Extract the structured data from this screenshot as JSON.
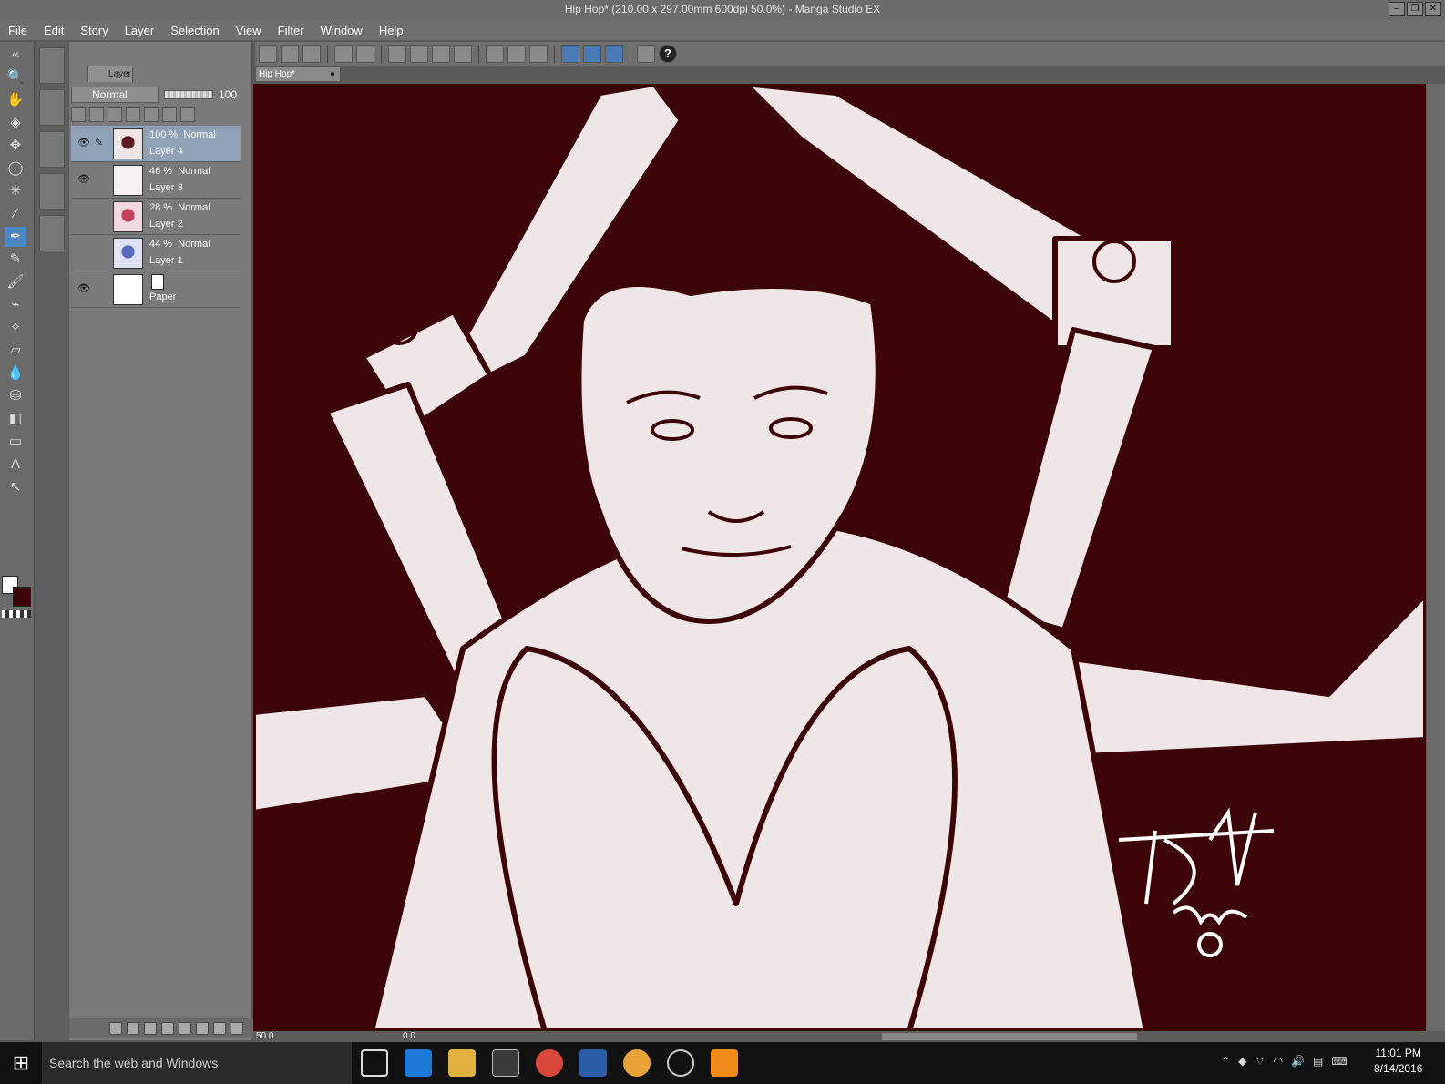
{
  "window": {
    "title": "Hip Hop* (210.00 x 297.00mm 600dpi 50.0%) - Manga Studio EX"
  },
  "menu": [
    "File",
    "Edit",
    "Story",
    "Layer",
    "Selection",
    "View",
    "Filter",
    "Window",
    "Help"
  ],
  "layer_panel": {
    "tab_label": "Layer",
    "blend_mode": "Normal",
    "opacity": "100",
    "layers": [
      {
        "opacity": "100 %",
        "mode": "Normal",
        "name": "Layer 4",
        "visible": true,
        "selected": true
      },
      {
        "opacity": "46 %",
        "mode": "Normal",
        "name": "Layer 3",
        "visible": true,
        "selected": false
      },
      {
        "opacity": "28 %",
        "mode": "Normal",
        "name": "Layer 2",
        "visible": false,
        "selected": false
      },
      {
        "opacity": "44 %",
        "mode": "Normal",
        "name": "Layer 1",
        "visible": false,
        "selected": false
      },
      {
        "name": "Paper",
        "visible": true,
        "selected": false
      }
    ]
  },
  "document_tab": {
    "label": "Hip Hop*"
  },
  "status": {
    "zoom": "50.0",
    "rotation": "0.0"
  },
  "colors": {
    "canvas_bg": "#3c0407",
    "foreground": "#ffffff",
    "background": "#3d0408",
    "accent": "#4f87c4"
  },
  "taskbar": {
    "search_placeholder": "Search the web and Windows",
    "time": "11:01 PM",
    "date": "8/14/2016"
  }
}
